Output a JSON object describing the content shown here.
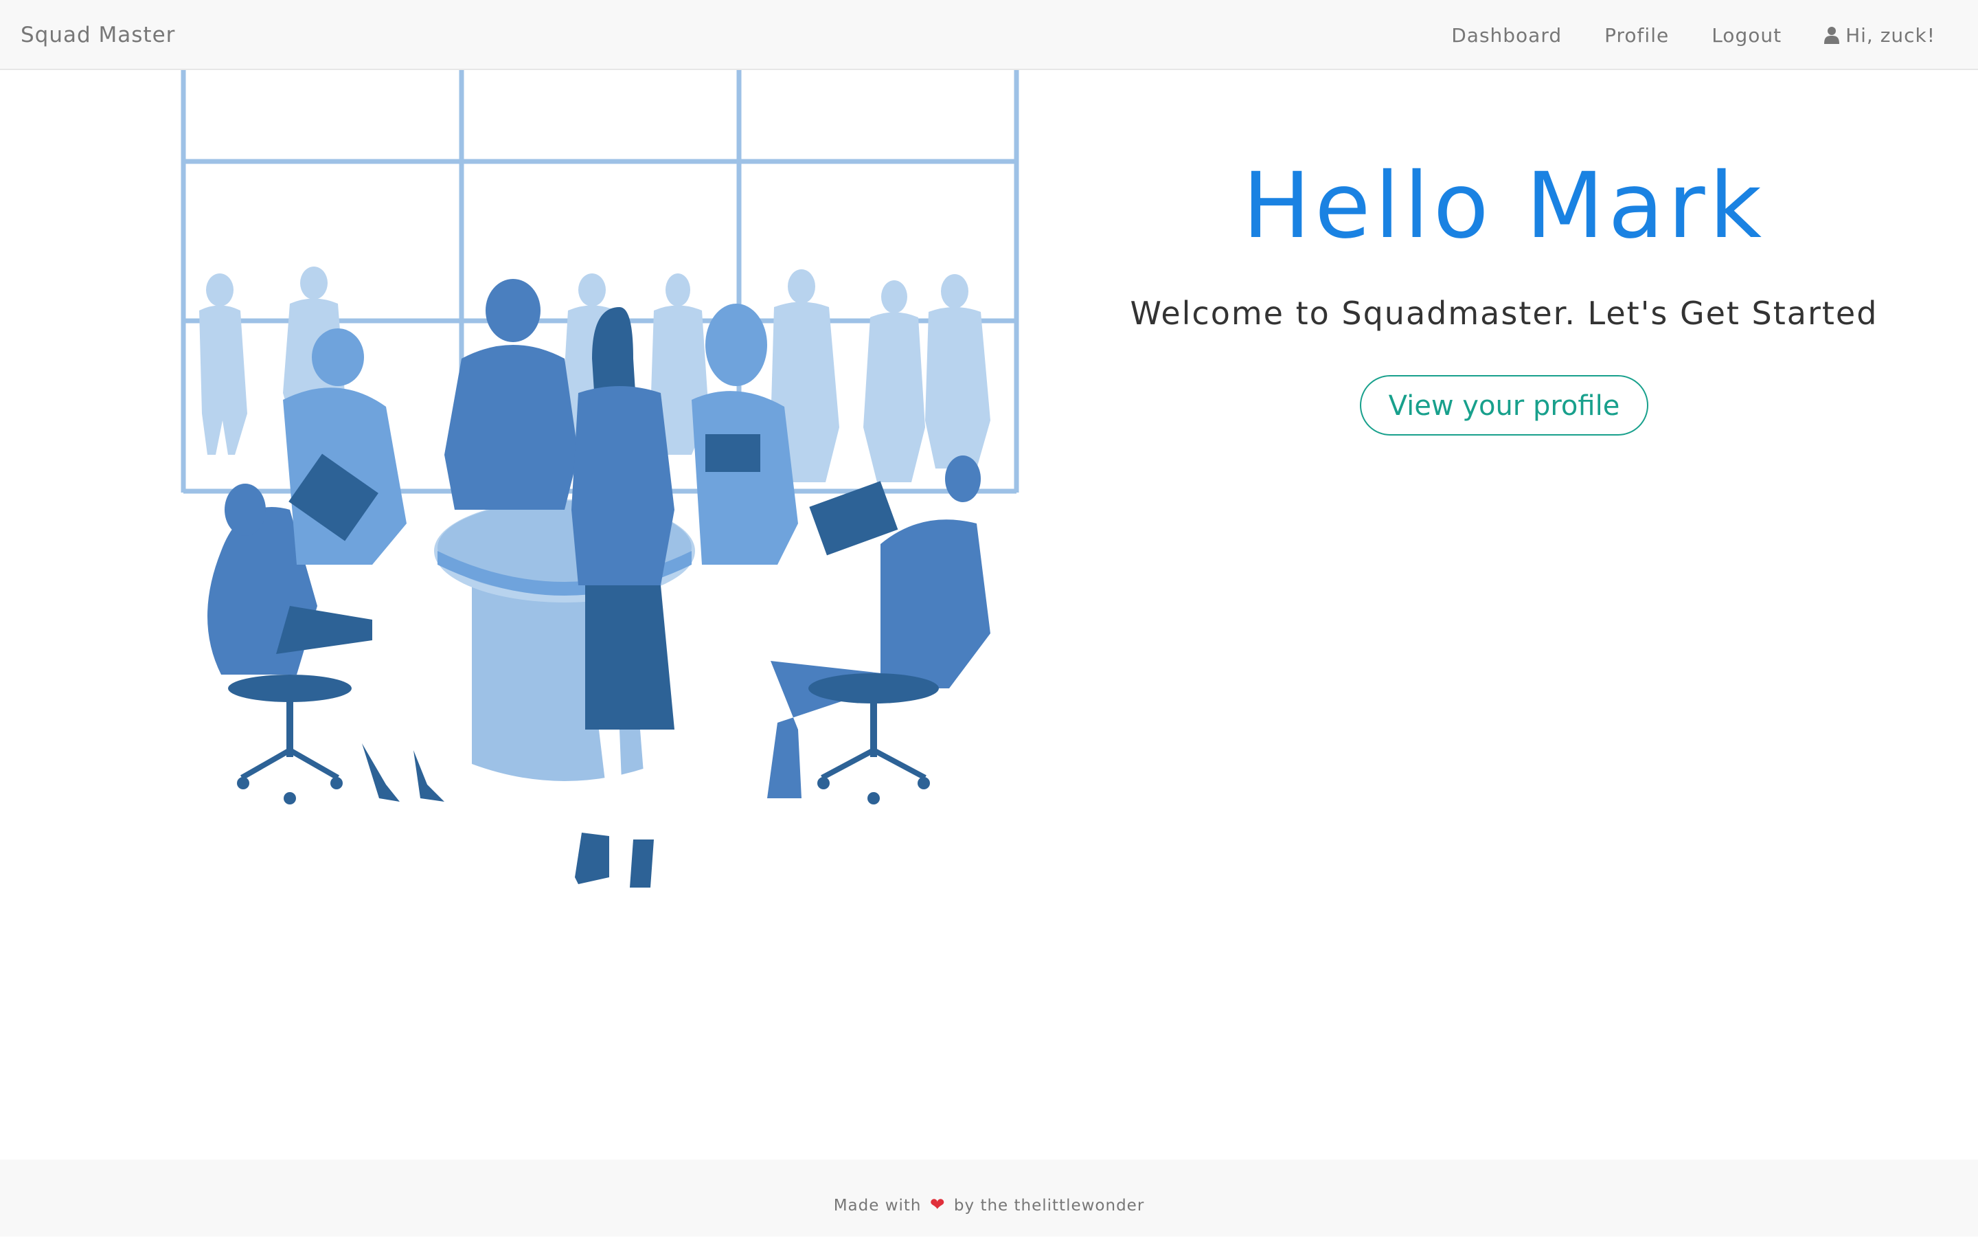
{
  "navbar": {
    "brand": "Squad Master",
    "links": {
      "dashboard": "Dashboard",
      "profile": "Profile",
      "logout": "Logout"
    },
    "user_greeting": "Hi, zuck!",
    "user_icon": "user-icon"
  },
  "hero": {
    "title": "Hello Mark",
    "subtitle": "Welcome to Squadmaster. Let's Get Started",
    "button_label": "View your profile"
  },
  "illustration": {
    "subject": "team-meeting-illustration",
    "colors": {
      "dark": "#2d6296",
      "mid": "#4a7fbf",
      "light": "#6fa3dc",
      "pale": "#9dc1e6",
      "faint": "#b8d3ee"
    }
  },
  "footer": {
    "prefix": "Made with",
    "heart": "❤",
    "suffix": "by the thelittlewonder"
  },
  "colors": {
    "accent": "#1a82e2",
    "button": "#18a08c",
    "nav_bg": "#f8f8f8",
    "nav_text": "#777777",
    "heart": "#e0303b"
  }
}
